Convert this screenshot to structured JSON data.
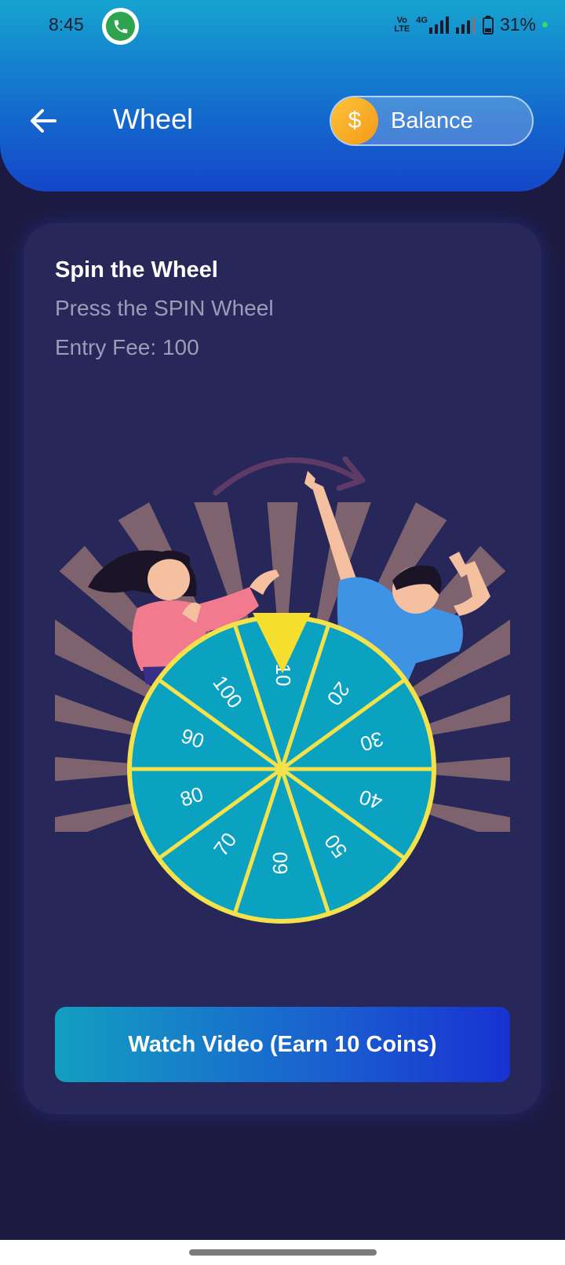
{
  "status_bar": {
    "time": "8:45",
    "network_tag_top": "Vo",
    "network_tag_bottom": "LTE",
    "network_type": "4G",
    "battery": "31%"
  },
  "header": {
    "title": "Wheel",
    "balance_label": "Balance",
    "coin_symbol": "$"
  },
  "card": {
    "title": "Spin the Wheel",
    "subtitle": "Press the SPIN Wheel",
    "entry_fee": "Entry Fee: 100"
  },
  "wheel": {
    "segments": [
      "10",
      "20",
      "30",
      "40",
      "50",
      "60",
      "70",
      "80",
      "90",
      "100"
    ],
    "colors": {
      "fill": "#0aa2c0",
      "rim": "#f5e24a",
      "pointer": "#f7df2f"
    }
  },
  "button": {
    "watch_video_label": "Watch Video (Earn 10 Coins)"
  },
  "icons": {
    "back": "arrow-left-icon",
    "coin": "dollar-coin-icon",
    "whatsapp": "phone-icon",
    "pointer": "triangle-pointer-icon"
  }
}
